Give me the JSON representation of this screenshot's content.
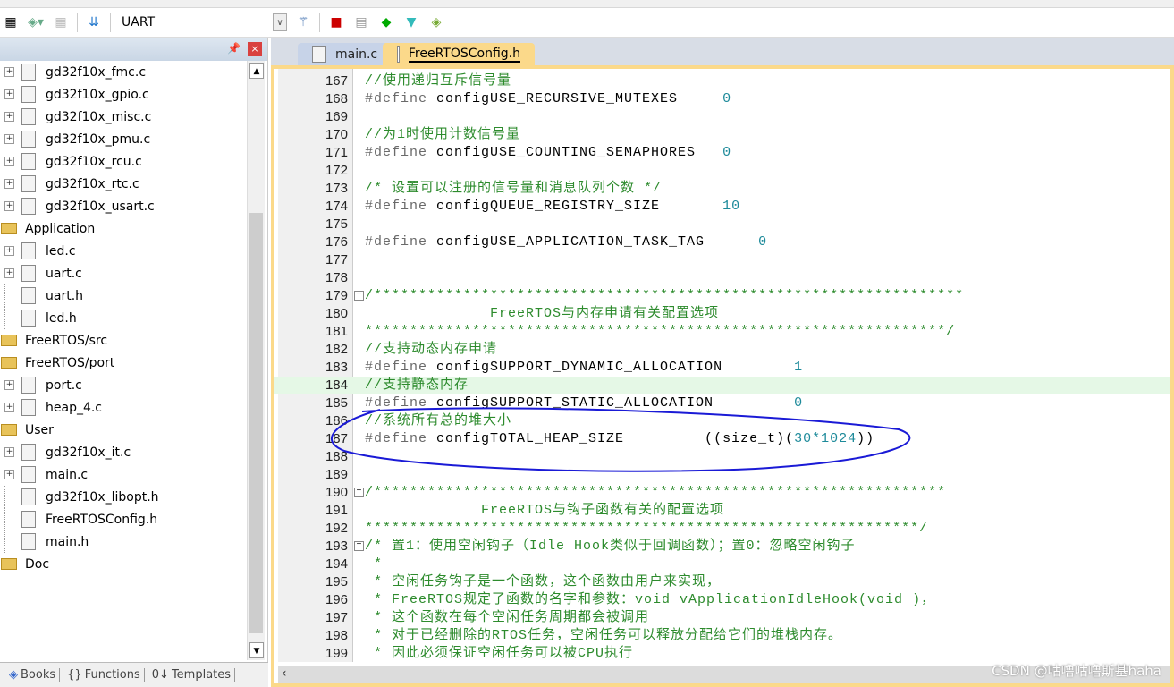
{
  "toolbar": {
    "target": "UART",
    "icons": [
      "batch-build-icon",
      "translate-icon",
      "stop-build-icon",
      "load-icon",
      "target-dropdown",
      "wizard-icon",
      "manage-components-icon",
      "windows-icon",
      "pack-icon",
      "filter-icon",
      "pack-installer-icon"
    ]
  },
  "panel": {
    "tree": [
      {
        "label": "gd32f10x_fmc.c",
        "type": "file",
        "expand": true
      },
      {
        "label": "gd32f10x_gpio.c",
        "type": "file",
        "expand": true
      },
      {
        "label": "gd32f10x_misc.c",
        "type": "file",
        "expand": true
      },
      {
        "label": "gd32f10x_pmu.c",
        "type": "file",
        "expand": true
      },
      {
        "label": "gd32f10x_rcu.c",
        "type": "file",
        "expand": true
      },
      {
        "label": "gd32f10x_rtc.c",
        "type": "file",
        "expand": true
      },
      {
        "label": "gd32f10x_usart.c",
        "type": "file",
        "expand": true
      },
      {
        "label": "Application",
        "type": "folder"
      },
      {
        "label": "led.c",
        "type": "file",
        "expand": true
      },
      {
        "label": "uart.c",
        "type": "file",
        "expand": true
      },
      {
        "label": "uart.h",
        "type": "file",
        "expand": false
      },
      {
        "label": "led.h",
        "type": "file",
        "expand": false
      },
      {
        "label": "FreeRTOS/src",
        "type": "folder"
      },
      {
        "label": "FreeRTOS/port",
        "type": "folder"
      },
      {
        "label": "port.c",
        "type": "file",
        "expand": true
      },
      {
        "label": "heap_4.c",
        "type": "file",
        "expand": true
      },
      {
        "label": "User",
        "type": "folder"
      },
      {
        "label": "gd32f10x_it.c",
        "type": "file",
        "expand": true
      },
      {
        "label": "main.c",
        "type": "file",
        "expand": true
      },
      {
        "label": "gd32f10x_libopt.h",
        "type": "file",
        "expand": false
      },
      {
        "label": "FreeRTOSConfig.h",
        "type": "file",
        "expand": false
      },
      {
        "label": "main.h",
        "type": "file",
        "expand": false
      },
      {
        "label": "Doc",
        "type": "folder"
      }
    ],
    "tabs": [
      {
        "icon": "books-icon",
        "label": "Books"
      },
      {
        "icon": "functions-icon",
        "label": "Functions"
      },
      {
        "icon": "templates-icon",
        "label": "Templates"
      }
    ]
  },
  "editor": {
    "tabs": [
      {
        "label": "main.c",
        "active": false
      },
      {
        "label": "FreeRTOSConfig.h",
        "active": true
      }
    ],
    "lines": [
      {
        "n": "167",
        "c": "//使用递归互斥信号量"
      },
      {
        "n": "168",
        "d": "#define",
        "name": " configUSE_RECURSIVE_MUTEXES     ",
        "v": "0"
      },
      {
        "n": "169"
      },
      {
        "n": "170",
        "c": "//为1时使用计数信号量"
      },
      {
        "n": "171",
        "d": "#define",
        "name": " configUSE_COUNTING_SEMAPHORES   ",
        "v": "0"
      },
      {
        "n": "172"
      },
      {
        "n": "173",
        "c": "/* 设置可以注册的信号量和消息队列个数 */"
      },
      {
        "n": "174",
        "d": "#define",
        "name": " configQUEUE_REGISTRY_SIZE       ",
        "v": "10"
      },
      {
        "n": "175"
      },
      {
        "n": "176",
        "d": "#define",
        "name": " configUSE_APPLICATION_TASK_TAG      ",
        "v": "0"
      },
      {
        "n": "177"
      },
      {
        "n": "178"
      },
      {
        "n": "179",
        "fold": true,
        "c": "/******************************************************************"
      },
      {
        "n": "180",
        "c": "              FreeRTOS与内存申请有关配置选项"
      },
      {
        "n": "181",
        "c": "*****************************************************************/"
      },
      {
        "n": "182",
        "c": "//支持动态内存申请"
      },
      {
        "n": "183",
        "d": "#define",
        "name": " configSUPPORT_DYNAMIC_ALLOCATION        ",
        "v": "1"
      },
      {
        "n": "184",
        "c": "//支持静态内存",
        "hl": true
      },
      {
        "n": "185",
        "d": "#define",
        "name": " configSUPPORT_STATIC_ALLOCATION         ",
        "v": "0"
      },
      {
        "n": "186",
        "c": "//系统所有总的堆大小"
      },
      {
        "n": "187",
        "d": "#define",
        "name": " configTOTAL_HEAP_SIZE         ((size_t)(",
        "v": "30*1024",
        "tail": "))"
      },
      {
        "n": "188"
      },
      {
        "n": "189"
      },
      {
        "n": "190",
        "fold": true,
        "c": "/****************************************************************"
      },
      {
        "n": "191",
        "c": "             FreeRTOS与钩子函数有关的配置选项"
      },
      {
        "n": "192",
        "c": "**************************************************************/"
      },
      {
        "n": "193",
        "fold": true,
        "c": "/* 置1：使用空闲钩子（Idle Hook类似于回调函数）；置0：忽略空闲钩子"
      },
      {
        "n": "194",
        "c": " *"
      },
      {
        "n": "195",
        "c": " * 空闲任务钩子是一个函数，这个函数由用户来实现，"
      },
      {
        "n": "196",
        "c": " * FreeRTOS规定了函数的名字和参数：void vApplicationIdleHook(void )，"
      },
      {
        "n": "197",
        "c": " * 这个函数在每个空闲任务周期都会被调用"
      },
      {
        "n": "198",
        "c": " * 对于已经删除的RTOS任务，空闲任务可以释放分配给它们的堆栈内存。"
      },
      {
        "n": "199",
        "c": " * 因此必须保证空闲任务可以被CPU执行"
      }
    ]
  },
  "watermark": "CSDN @咕噜咕噜斯基haha",
  "colors": {
    "comment": "#2d8b2d",
    "number": "#1d8a9a",
    "activeTab": "#fbd98a",
    "annotation": "#1a1ad6"
  }
}
